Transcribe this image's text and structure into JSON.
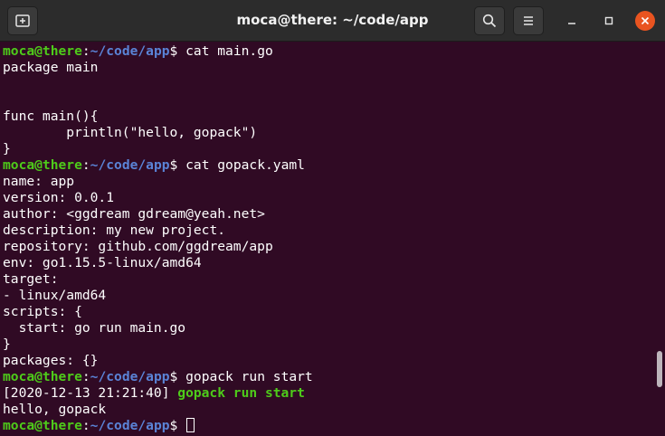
{
  "window": {
    "title": "moca@there: ~/code/app"
  },
  "prompt": {
    "user_host": "moca@there",
    "colon": ":",
    "path": "~/code/app",
    "symbol": "$"
  },
  "lines": [
    {
      "type": "prompt",
      "cmd": " cat main.go"
    },
    {
      "type": "text",
      "text": "package main"
    },
    {
      "type": "text",
      "text": ""
    },
    {
      "type": "text",
      "text": ""
    },
    {
      "type": "text",
      "text": "func main(){"
    },
    {
      "type": "text",
      "text": "        println(\"hello, gopack\")"
    },
    {
      "type": "text",
      "text": "}"
    },
    {
      "type": "prompt",
      "cmd": " cat gopack.yaml"
    },
    {
      "type": "text",
      "text": "name: app"
    },
    {
      "type": "text",
      "text": "version: 0.0.1"
    },
    {
      "type": "text",
      "text": "author: <ggdream gdream@yeah.net>"
    },
    {
      "type": "text",
      "text": "description: my new project."
    },
    {
      "type": "text",
      "text": "repository: github.com/ggdream/app"
    },
    {
      "type": "text",
      "text": "env: go1.15.5-linux/amd64"
    },
    {
      "type": "text",
      "text": "target:"
    },
    {
      "type": "text",
      "text": "- linux/amd64"
    },
    {
      "type": "text",
      "text": "scripts: {"
    },
    {
      "type": "text",
      "text": "  start: go run main.go"
    },
    {
      "type": "text",
      "text": "}"
    },
    {
      "type": "text",
      "text": "packages: {}"
    },
    {
      "type": "prompt",
      "cmd": " gopack run start"
    },
    {
      "type": "log",
      "time": "[2020-12-13 21:21:40] ",
      "msg": "gopack run start"
    },
    {
      "type": "text",
      "text": "hello, gopack"
    },
    {
      "type": "prompt",
      "cmd": " ",
      "cursor": true
    }
  ],
  "icons": {
    "new_tab": "new-tab-icon",
    "search": "search-icon",
    "menu": "hamburger-menu-icon",
    "minimize": "minimize-icon",
    "maximize": "maximize-icon",
    "close": "close-icon"
  },
  "colors": {
    "background": "#300a24",
    "titlebar": "#2c2c2c",
    "user_host": "#4ecb1a",
    "path": "#5a83d6",
    "close_button": "#e95420"
  }
}
